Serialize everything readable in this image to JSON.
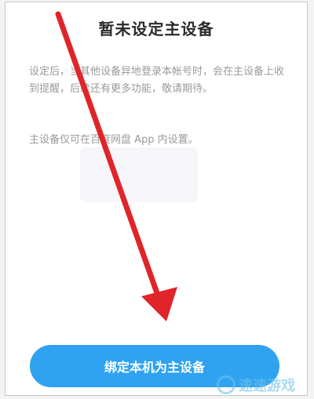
{
  "dialog": {
    "title": "暂未设定主设备",
    "description_1": "设定后，当其他设备异地登录本帐号时，会在主设备上收到提醒，后续还有更多功能，敬请期待。",
    "description_2": "主设备仅可在百度网盘 App 内设置。",
    "bind_button_label": "绑定本机为主设备"
  },
  "watermark": {
    "text": "速速游戏"
  },
  "annotation": {
    "arrow_color": "#e0242a",
    "button_color": "#2fa3f1"
  },
  "icons": {
    "logo": "watermark-logo-icon"
  }
}
